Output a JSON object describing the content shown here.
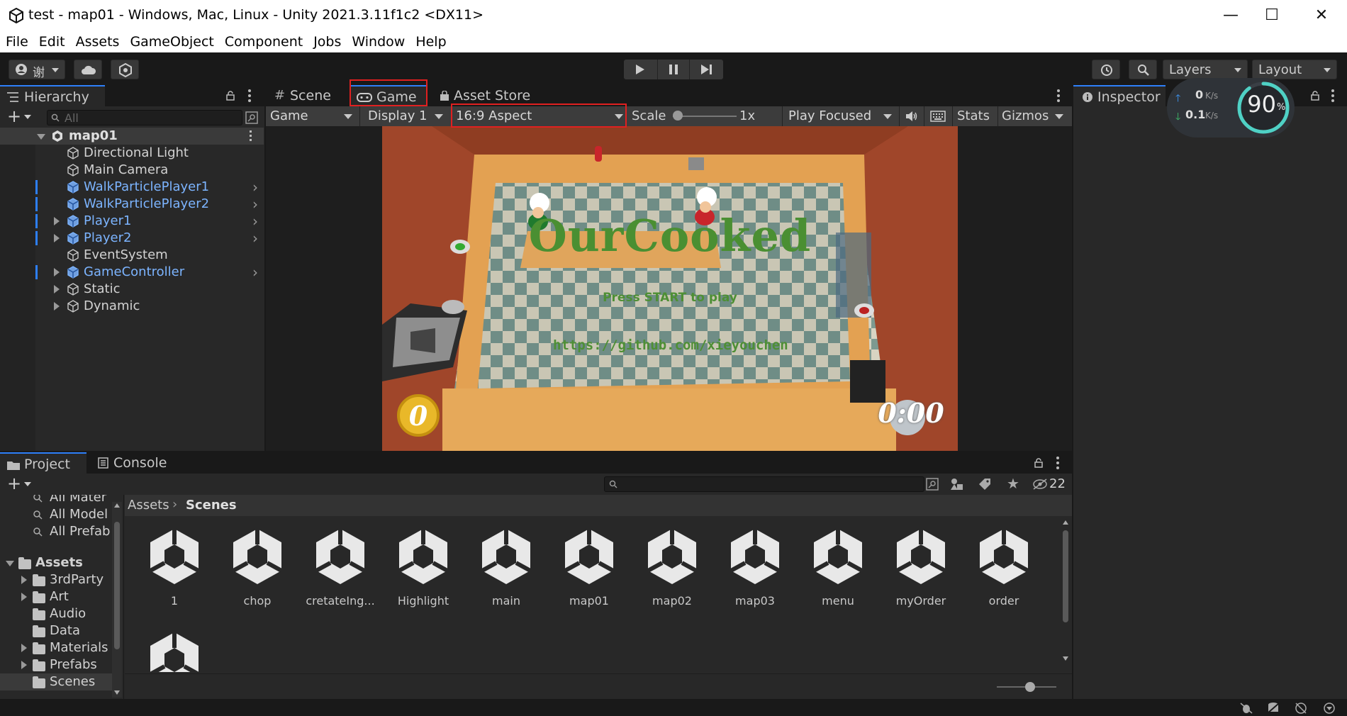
{
  "window": {
    "title": "test - map01 - Windows, Mac, Linux - Unity 2021.3.11f1c2 <DX11>",
    "controls": {
      "minimize": "—",
      "maximize": "☐",
      "close": "✕"
    }
  },
  "menu": [
    "File",
    "Edit",
    "Assets",
    "GameObject",
    "Component",
    "Jobs",
    "Window",
    "Help"
  ],
  "toolbar": {
    "account_label": "谢",
    "layers_label": "Layers",
    "layout_label": "Layout"
  },
  "hierarchy": {
    "tab_label": "Hierarchy",
    "search_placeholder": "All",
    "scene_name": "map01",
    "items": [
      {
        "label": "Directional Light",
        "prefab": false,
        "expandable": false
      },
      {
        "label": "Main Camera",
        "prefab": false,
        "expandable": false
      },
      {
        "label": "WalkParticlePlayer1",
        "prefab": true,
        "expandable": false
      },
      {
        "label": "WalkParticlePlayer2",
        "prefab": true,
        "expandable": false
      },
      {
        "label": "Player1",
        "prefab": true,
        "expandable": true
      },
      {
        "label": "Player2",
        "prefab": true,
        "expandable": true
      },
      {
        "label": "EventSystem",
        "prefab": false,
        "expandable": false
      },
      {
        "label": "GameController",
        "prefab": true,
        "expandable": true
      },
      {
        "label": "Static",
        "prefab": false,
        "expandable": true
      },
      {
        "label": "Dynamic",
        "prefab": false,
        "expandable": true
      }
    ]
  },
  "center_tabs": {
    "scene": "Scene",
    "game": "Game",
    "asset_store": "Asset Store"
  },
  "game_toolbar": {
    "mode": "Game",
    "display": "Display 1",
    "aspect": "16:9 Aspect",
    "scale_label": "Scale",
    "scale_value": "1x",
    "play_focused": "Play Focused",
    "stats": "Stats",
    "gizmos": "Gizmos"
  },
  "game_view": {
    "title_text": "OurCooked",
    "prompt_text": "Press START to play",
    "url_text": "https://github.com/xieyouchen",
    "score": "0",
    "timer": "0:00"
  },
  "inspector": {
    "tab_label": "Inspector",
    "upload_speed": "0",
    "download_speed": "0.1",
    "speed_unit": "K/s",
    "cpu_percent": "90",
    "cpu_unit": "%",
    "cpu_level": 0.9
  },
  "project": {
    "tab_project": "Project",
    "tab_console": "Console",
    "hidden_count": "22",
    "breadcrumb": [
      "Assets",
      "Scenes"
    ],
    "favorites": [
      "All Mater",
      "All Model",
      "All Prefab"
    ],
    "tree": [
      {
        "label": "Assets",
        "level": 0,
        "expanded": true
      },
      {
        "label": "3rdParty",
        "level": 1,
        "expanded": false
      },
      {
        "label": "Art",
        "level": 1,
        "expanded": false
      },
      {
        "label": "Audio",
        "level": 1,
        "expanded": null
      },
      {
        "label": "Data",
        "level": 1,
        "expanded": null
      },
      {
        "label": "Materials",
        "level": 1,
        "expanded": false
      },
      {
        "label": "Prefabs",
        "level": 1,
        "expanded": false
      },
      {
        "label": "Scenes",
        "level": 1,
        "expanded": null
      }
    ],
    "assets": [
      "1",
      "chop",
      "cretateIng...",
      "Highlight",
      "main",
      "map01",
      "map02",
      "map03",
      "menu",
      "myOrder",
      "order",
      ""
    ]
  },
  "colors": {
    "accent_blue": "#2d7ff9",
    "prefab_blue": "#7cb4ff",
    "highlight_red": "#e02020",
    "title_green": "#5a9b3a"
  }
}
